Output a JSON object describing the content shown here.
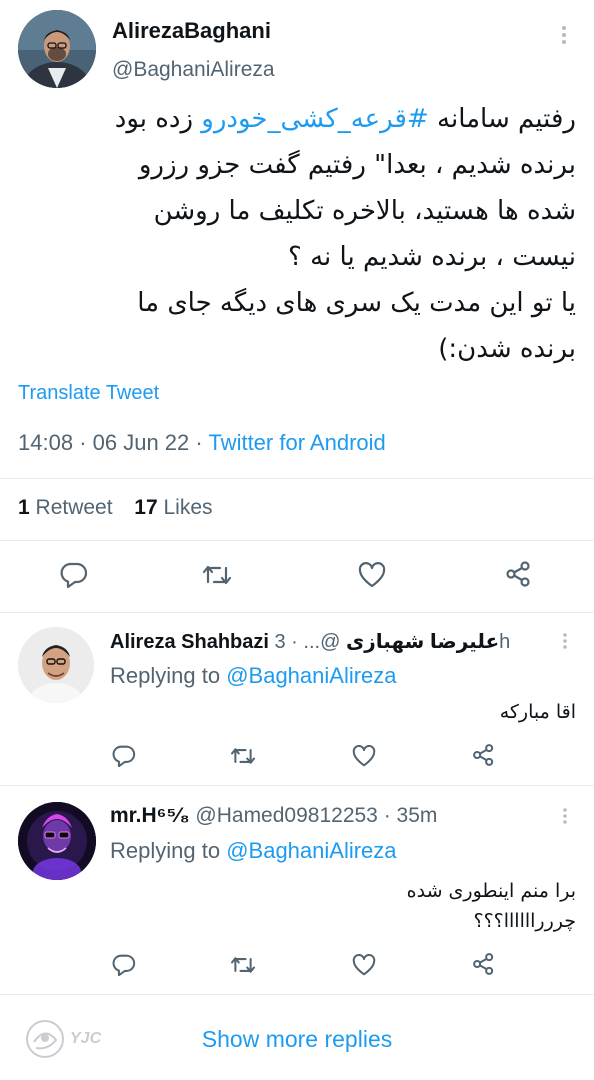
{
  "tweet": {
    "display_name": "AlirezaBaghani",
    "handle": "@BaghaniAlireza",
    "text_lines": [
      {
        "pre": "رفتیم سامانه ",
        "hashtag": "#قرعه_کشی_خودرو",
        "post": " زده بود"
      },
      {
        "pre": "برنده شدیم ، بعدا\" رفتیم گفت جزو رزرو",
        "hashtag": "",
        "post": ""
      },
      {
        "pre": "شده ها هستید، بالاخره تکلیف ما روشن",
        "hashtag": "",
        "post": ""
      },
      {
        "pre": "نیست ، برنده شدیم یا نه ؟",
        "hashtag": "",
        "post": ""
      },
      {
        "pre": "یا تو این مدت یک سری های دیگه جای ما",
        "hashtag": "",
        "post": ""
      },
      {
        "pre": "برنده شدن:)",
        "hashtag": "",
        "post": ""
      }
    ],
    "translate_label": "Translate Tweet",
    "time": "14:08",
    "sep1": "·",
    "date": "06 Jun 22",
    "sep2": "·",
    "client": "Twitter for Android",
    "retweet_count": "1",
    "retweet_label": "Retweet",
    "likes_count": "17",
    "likes_label": "Likes"
  },
  "replies": [
    {
      "name": "Alireza Shahbazi علیرضا شهبازی",
      "meta": "@... · 3h",
      "replying_prefix": "Replying to",
      "replying_handle": "@BaghaniAlireza",
      "text_lines": [
        "اقا مبارکه"
      ]
    },
    {
      "name": "mr.H⁶⁵⁄₈",
      "meta": "@Hamed09812253 · 35m",
      "replying_prefix": "Replying to",
      "replying_handle": "@BaghaniAlireza",
      "text_lines": [
        "برا منم اینطوری شده",
        "چررراااااا؟؟؟"
      ]
    }
  ],
  "footer": {
    "watermark": "YJC",
    "show_more": "Show more replies"
  },
  "colors": {
    "accent": "#1d9bf0",
    "text": "#0f1419",
    "muted": "#536471"
  },
  "icons": [
    "reply-icon",
    "retweet-icon",
    "like-icon",
    "share-icon",
    "more-icon"
  ]
}
